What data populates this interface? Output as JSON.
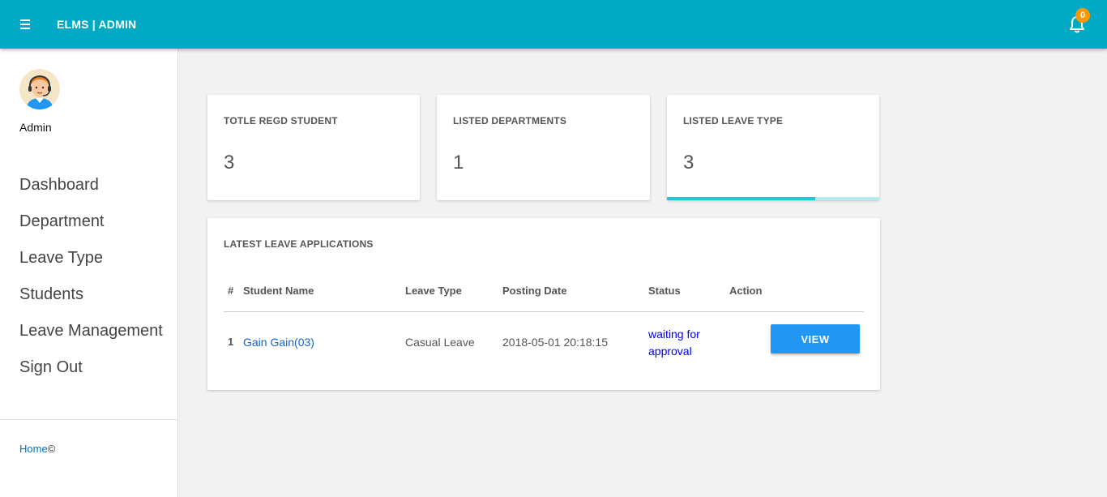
{
  "header": {
    "brand": "ELMS | ADMIN",
    "notification_count": "0"
  },
  "sidebar": {
    "user_name": "Admin",
    "items": [
      {
        "label": "Dashboard"
      },
      {
        "label": "Department"
      },
      {
        "label": "Leave Type"
      },
      {
        "label": "Students"
      },
      {
        "label": "Leave Management"
      },
      {
        "label": "Sign Out"
      }
    ],
    "footer_link": "Home",
    "footer_suffix": "©"
  },
  "stats": [
    {
      "title": "TOTLE REGD STUDENT",
      "value": "3"
    },
    {
      "title": "LISTED DEPARTMENTS",
      "value": "1"
    },
    {
      "title": "LISTED LEAVE TYPE",
      "value": "3",
      "progress_fraction": 0.7
    }
  ],
  "table": {
    "title": "LATEST LEAVE APPLICATIONS",
    "columns": [
      "#",
      "Student Name",
      "Leave Type",
      "Posting Date",
      "Status",
      "Action"
    ],
    "rows": [
      {
        "index": "1",
        "student": "Gain Gain(03)",
        "leave_type": "Casual Leave",
        "posting_date": "2018-05-01 20:18:15",
        "status_line1": "waiting for",
        "status_line2": "approval",
        "action": "VIEW"
      }
    ]
  },
  "colors": {
    "topbar": "#00aac4",
    "badge": "#ff9800",
    "button": "#2196f3",
    "progress": "#26c6da",
    "status": "#0000ee"
  }
}
